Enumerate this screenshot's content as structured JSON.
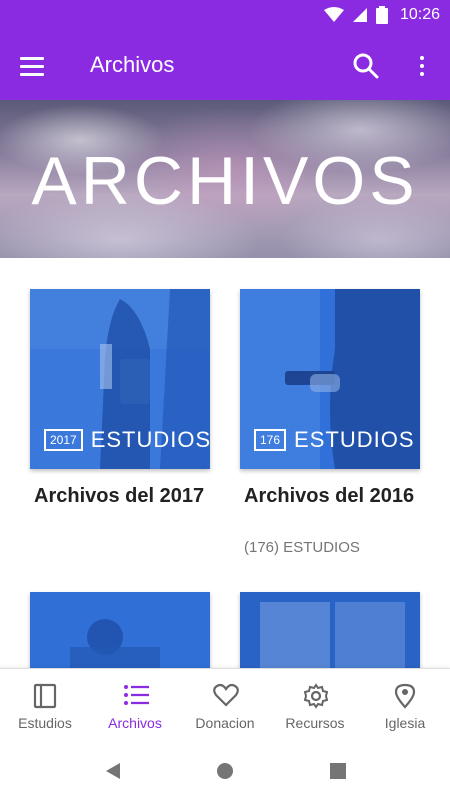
{
  "status_bar": {
    "time": "10:26"
  },
  "app_bar": {
    "title": "Archivos"
  },
  "hero": {
    "title": "ARCHIVOS"
  },
  "cards": [
    {
      "badge_number": "2017",
      "badge_word": "ESTUDIOS",
      "title": "Archivos del 2017",
      "subtitle": ""
    },
    {
      "badge_number": "176",
      "badge_word": "ESTUDIOS",
      "title": "Archivos del 2016",
      "subtitle": "(176) ESTUDIOS"
    }
  ],
  "bottom_nav": {
    "items": [
      {
        "label": "Estudios",
        "icon": "book-icon",
        "active": false
      },
      {
        "label": "Archivos",
        "icon": "list-icon",
        "active": true
      },
      {
        "label": "Donacion",
        "icon": "heart-icon",
        "active": false
      },
      {
        "label": "Recursos",
        "icon": "gear-icon",
        "active": false
      },
      {
        "label": "Iglesia",
        "icon": "location-pin-icon",
        "active": false
      }
    ]
  },
  "colors": {
    "primary": "#8a2be2",
    "card_blue": "#2f6fd6",
    "inactive": "#666666"
  }
}
